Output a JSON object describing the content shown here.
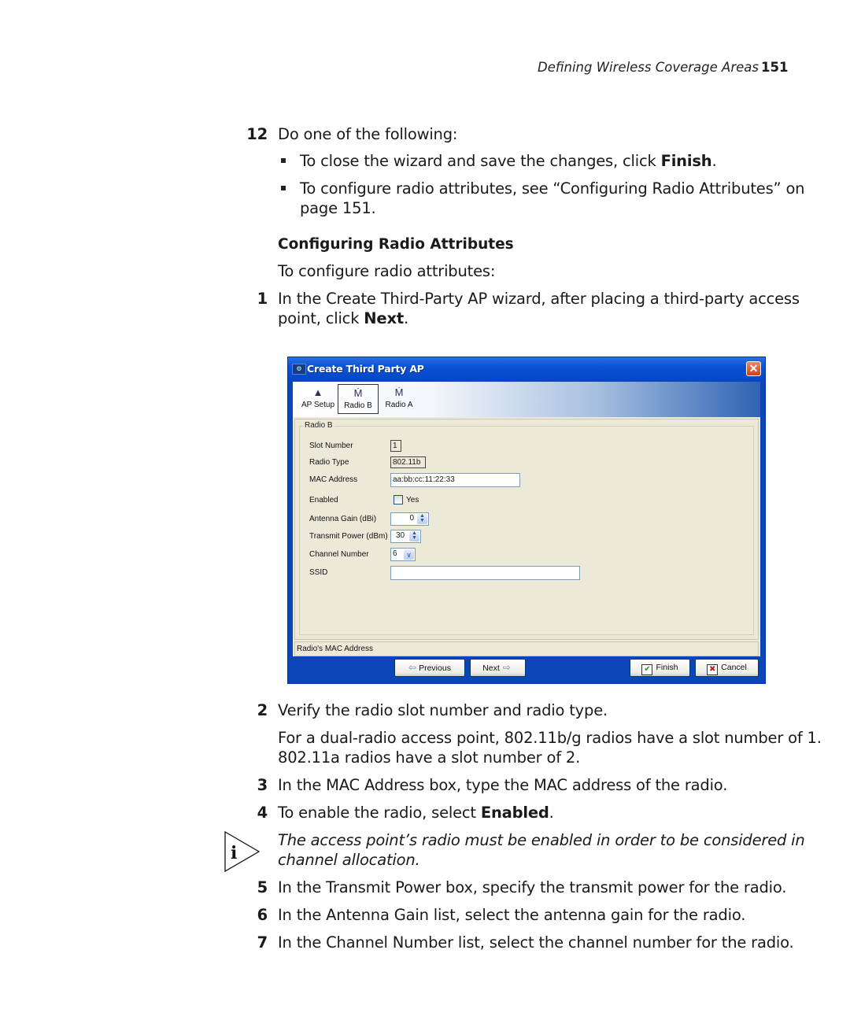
{
  "header": {
    "running_title": "Defining Wireless Coverage Areas",
    "page_number": "151"
  },
  "step12": {
    "number": "12",
    "text": "Do one of the following:",
    "bullets": [
      {
        "pre": "To close the wizard and save the changes, click ",
        "bold": "Finish",
        "post": "."
      },
      {
        "line1": "To configure radio attributes, see “Configuring Radio Attributes” on",
        "line2": "page 151."
      }
    ]
  },
  "section": {
    "heading": "Configuring Radio Attributes",
    "intro": "To configure radio attributes:"
  },
  "steps": [
    {
      "number": "1",
      "line1": "In the Create Third-Party AP wizard, after placing a third-party access",
      "line2_pre": "point, click ",
      "line2_bold": "Next",
      "line2_post": "."
    },
    {
      "number": "2",
      "text": "Verify the radio slot number and radio type.",
      "para_line1": "For a dual-radio access point, 802.11b/g radios have a slot number of 1.",
      "para_line2": "802.11a radios have a slot number of 2."
    },
    {
      "number": "3",
      "text": "In the MAC Address box, type the MAC address of the radio."
    },
    {
      "number": "4",
      "pre": "To enable the radio, select ",
      "bold": "Enabled",
      "post": "."
    },
    {
      "number": "5",
      "text": "In the Transmit Power box, specify the transmit power for the radio."
    },
    {
      "number": "6",
      "text": "In the Antenna Gain list, select the antenna gain for the radio."
    },
    {
      "number": "7",
      "text": "In the Channel Number list, select the channel number for the radio."
    }
  ],
  "note": {
    "icon": "info-icon",
    "line1": "The access point’s radio must be enabled in order to be considered in",
    "line2": "channel allocation."
  },
  "dialog": {
    "title": "Create Third Party AP",
    "title_icon": "app-icon",
    "close_icon": "close-icon",
    "tabs": [
      {
        "label": "AP Setup",
        "icon": "warning-triangle-icon",
        "active": false
      },
      {
        "label": "Radio B",
        "icon": "antenna-icon",
        "active": true
      },
      {
        "label": "Radio A",
        "icon": "antenna-icon",
        "active": false
      }
    ],
    "group_title": "Radio B",
    "fields": {
      "slot_number": {
        "label": "Slot Number",
        "value": "1"
      },
      "radio_type": {
        "label": "Radio Type",
        "value": "802.11b"
      },
      "mac_address": {
        "label": "MAC Address",
        "value": "aa:bb:cc:11:22:33"
      },
      "enabled": {
        "label": "Enabled",
        "option": "Yes",
        "checked": false
      },
      "antenna_gain": {
        "label": "Antenna Gain (dBi)",
        "value": "0"
      },
      "transmit_power": {
        "label": "Transmit Power (dBm)",
        "value": "30"
      },
      "channel_number": {
        "label": "Channel Number",
        "value": "6"
      },
      "ssid": {
        "label": "SSID",
        "value": ""
      }
    },
    "status_text": "Radio's MAC Address",
    "buttons": {
      "previous": "Previous",
      "next": "Next",
      "finish": "Finish",
      "cancel": "Cancel"
    }
  }
}
